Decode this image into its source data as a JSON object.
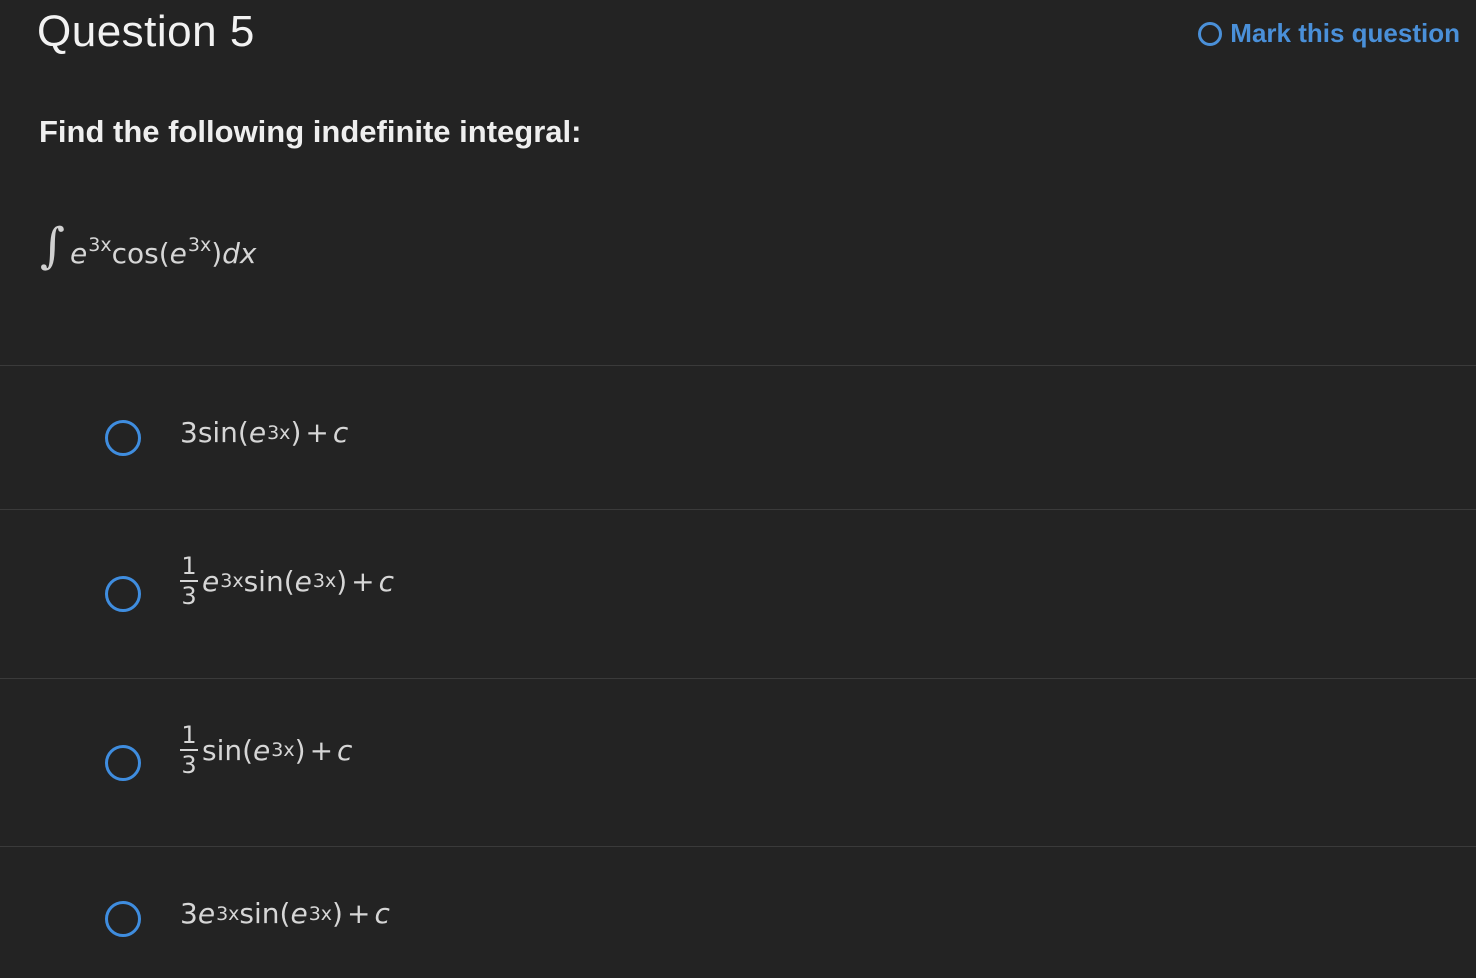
{
  "header": {
    "title": "Question 5",
    "mark_label": "Mark this question"
  },
  "question": {
    "prompt": "Find the following indefinite integral:",
    "integral": {
      "sign": "∫",
      "base1": "e",
      "exp1": "3x",
      "func": "cos(",
      "base2": "e",
      "exp2": "3x",
      "close": ")",
      "dx": "dx"
    }
  },
  "options": [
    {
      "coef": "3sin(",
      "base": "e",
      "exp": "3x",
      "tail": ")",
      "plus": "+",
      "c": "c"
    },
    {
      "num": "1",
      "den": "3",
      "base1": "e",
      "exp1": "3x",
      "func": "sin(",
      "base2": "e",
      "exp2": "3x",
      "tail": ")",
      "plus": "+",
      "c": "c"
    },
    {
      "num": "1",
      "den": "3",
      "func": "sin(",
      "base": "e",
      "exp": "3x",
      "tail": ")",
      "plus": "+",
      "c": "c"
    },
    {
      "coef": "3",
      "base1": "e",
      "exp1": "3x",
      "func": "sin(",
      "base2": "e",
      "exp2": "3x",
      "tail": ")",
      "plus": "+",
      "c": "c"
    }
  ],
  "colors": {
    "background": "#232323",
    "accent": "#4a90d9",
    "divider": "#3a3a3a"
  }
}
